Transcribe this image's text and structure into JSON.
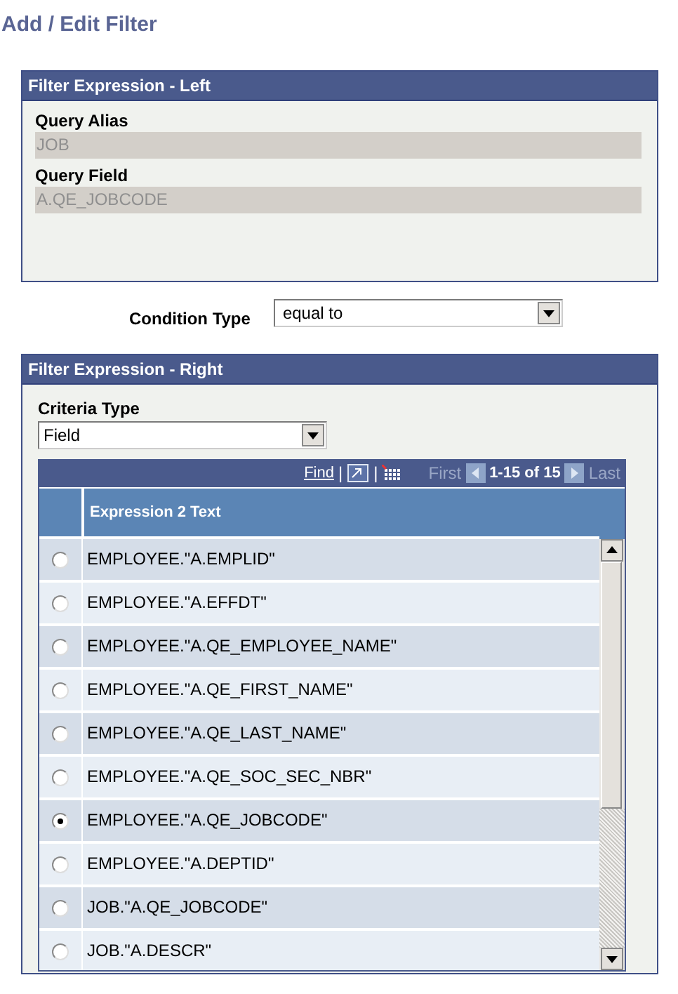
{
  "title": "Add / Edit Filter",
  "left_panel": {
    "title": "Filter Expression - Left",
    "fields": [
      {
        "label": "Query Alias",
        "value": "JOB"
      },
      {
        "label": "Query Field",
        "value": "A.QE_JOBCODE"
      }
    ]
  },
  "condition": {
    "label": "Condition Type",
    "value": "equal to"
  },
  "right_panel": {
    "title": "Filter Expression - Right",
    "criteria": {
      "label": "Criteria Type",
      "value": "Field"
    },
    "grid": {
      "find": "Find",
      "separator_1": "|",
      "separator_2": "|",
      "first": "First",
      "range": "1-15 of 15",
      "last": "Last",
      "column": "Expression 2 Text",
      "rows": [
        {
          "text": "EMPLOYEE.\"A.EMPLID\"",
          "selected": false
        },
        {
          "text": "EMPLOYEE.\"A.EFFDT\"",
          "selected": false
        },
        {
          "text": "EMPLOYEE.\"A.QE_EMPLOYEE_NAME\"",
          "selected": false
        },
        {
          "text": "EMPLOYEE.\"A.QE_FIRST_NAME\"",
          "selected": false
        },
        {
          "text": "EMPLOYEE.\"A.QE_LAST_NAME\"",
          "selected": false
        },
        {
          "text": "EMPLOYEE.\"A.QE_SOC_SEC_NBR\"",
          "selected": false
        },
        {
          "text": "EMPLOYEE.\"A.QE_JOBCODE\"",
          "selected": true
        },
        {
          "text": "EMPLOYEE.\"A.DEPTID\"",
          "selected": false
        },
        {
          "text": "JOB.\"A.QE_JOBCODE\"",
          "selected": false
        },
        {
          "text": "JOB.\"A.DESCR\"",
          "selected": false
        }
      ]
    }
  }
}
